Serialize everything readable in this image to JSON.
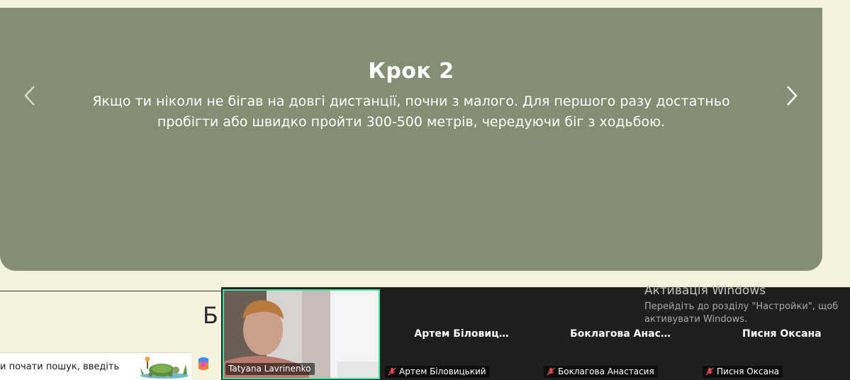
{
  "carousel": {
    "title": "Крок 2",
    "text": "Якщо ти ніколи не бігав на довгі дистанції, почни з малого. Для першого разу достатньо пробігти або швидко пройти 300-500 метрів, чередуючи біг з ходьбою.",
    "background_color": "#858d73",
    "prev_icon": "chevron-left-icon",
    "next_icon": "chevron-right-icon"
  },
  "page": {
    "heading_partial": "Б"
  },
  "taskbar": {
    "search_placeholder": "и почати пошук, введіть"
  },
  "meeting": {
    "participants": [
      {
        "name": "Tatyana Lavrinenko",
        "video": true,
        "muted": false
      },
      {
        "name": "Артем Біловицький",
        "display_name": "Артем Біловиц…",
        "muted": true
      },
      {
        "name": "Боклагова Анастасия",
        "display_name": "Боклагова  Анас…",
        "muted": true
      },
      {
        "name": "Писня Оксана",
        "display_name": "Писня Оксана",
        "muted": true
      }
    ],
    "active_speaker_color": "#3ce39a"
  },
  "watermark": {
    "title": "Активація Windows",
    "text": "Перейдіть до розділу \"Настройки\", щоб активувати Windows."
  }
}
